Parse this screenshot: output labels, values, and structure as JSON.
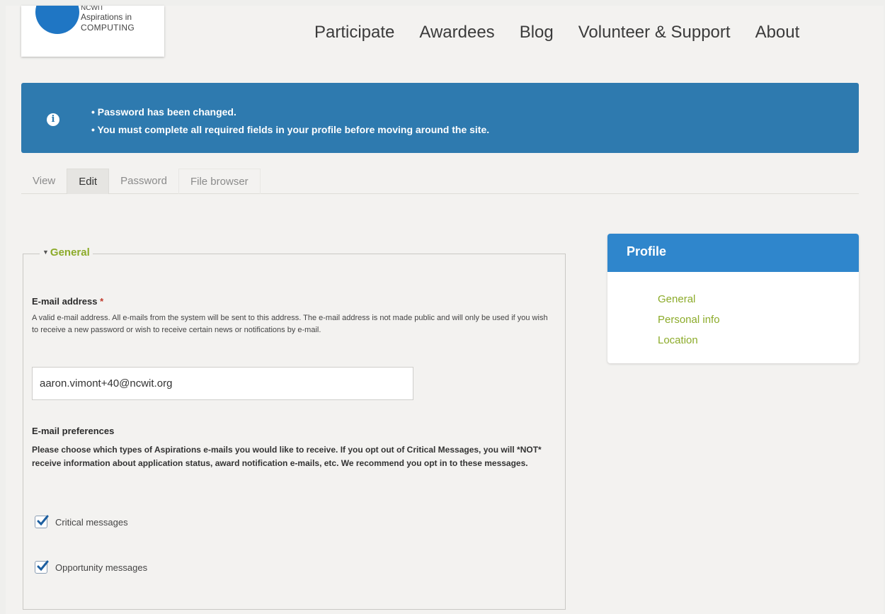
{
  "logo": {
    "line1": "NCWIT",
    "line2": "Aspirations in",
    "line3": "COMPUTING"
  },
  "nav": [
    "Participate",
    "Awardees",
    "Blog",
    "Volunteer & Support",
    "About"
  ],
  "messages": [
    "Password has been changed.",
    "You must complete all required fields in your profile before moving around the site."
  ],
  "tabs": [
    "View",
    "Edit",
    "Password",
    "File browser"
  ],
  "general": {
    "legend": "General",
    "email_label": "E-mail address",
    "required_mark": "*",
    "email_desc": "A valid e-mail address. All e-mails from the system will be sent to this address. The e-mail address is not made public and will only be used if you wish to receive a new password or wish to receive certain news or notifications by e-mail.",
    "email_value": "aaron.vimont+40@ncwit.org",
    "prefs_label": "E-mail preferences",
    "prefs_desc": "Please choose which types of Aspirations e-mails you would like to receive. If you opt out of Critical Messages, you will *NOT* receive information about application status, award notification e-mails, etc. We recommend you opt in to these messages.",
    "checkbox_critical": "Critical messages",
    "checkbox_opportunity": "Opportunity messages"
  },
  "profile": {
    "title": "Profile",
    "links": [
      "General",
      "Personal info",
      "Location"
    ]
  },
  "colors": {
    "alert_bg": "#2e7aaf",
    "accent_green": "#8cab2a",
    "profile_header": "#2f86cc"
  }
}
